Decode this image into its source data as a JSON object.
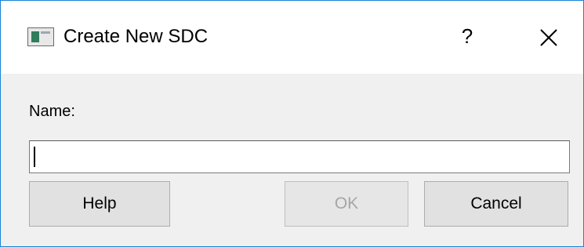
{
  "window": {
    "title": "Create New SDC",
    "help_glyph": "?",
    "close_icon": "close-icon",
    "app_icon": "window-icon"
  },
  "form": {
    "name_label": "Name:",
    "name_value": "",
    "name_placeholder": ""
  },
  "buttons": {
    "help_label": "Help",
    "ok_label": "OK",
    "ok_enabled": false,
    "cancel_label": "Cancel"
  },
  "colors": {
    "border_accent": "#1883d7",
    "disabled_text": "#a6a6a6",
    "dialog_bg": "#f0f0f0"
  }
}
